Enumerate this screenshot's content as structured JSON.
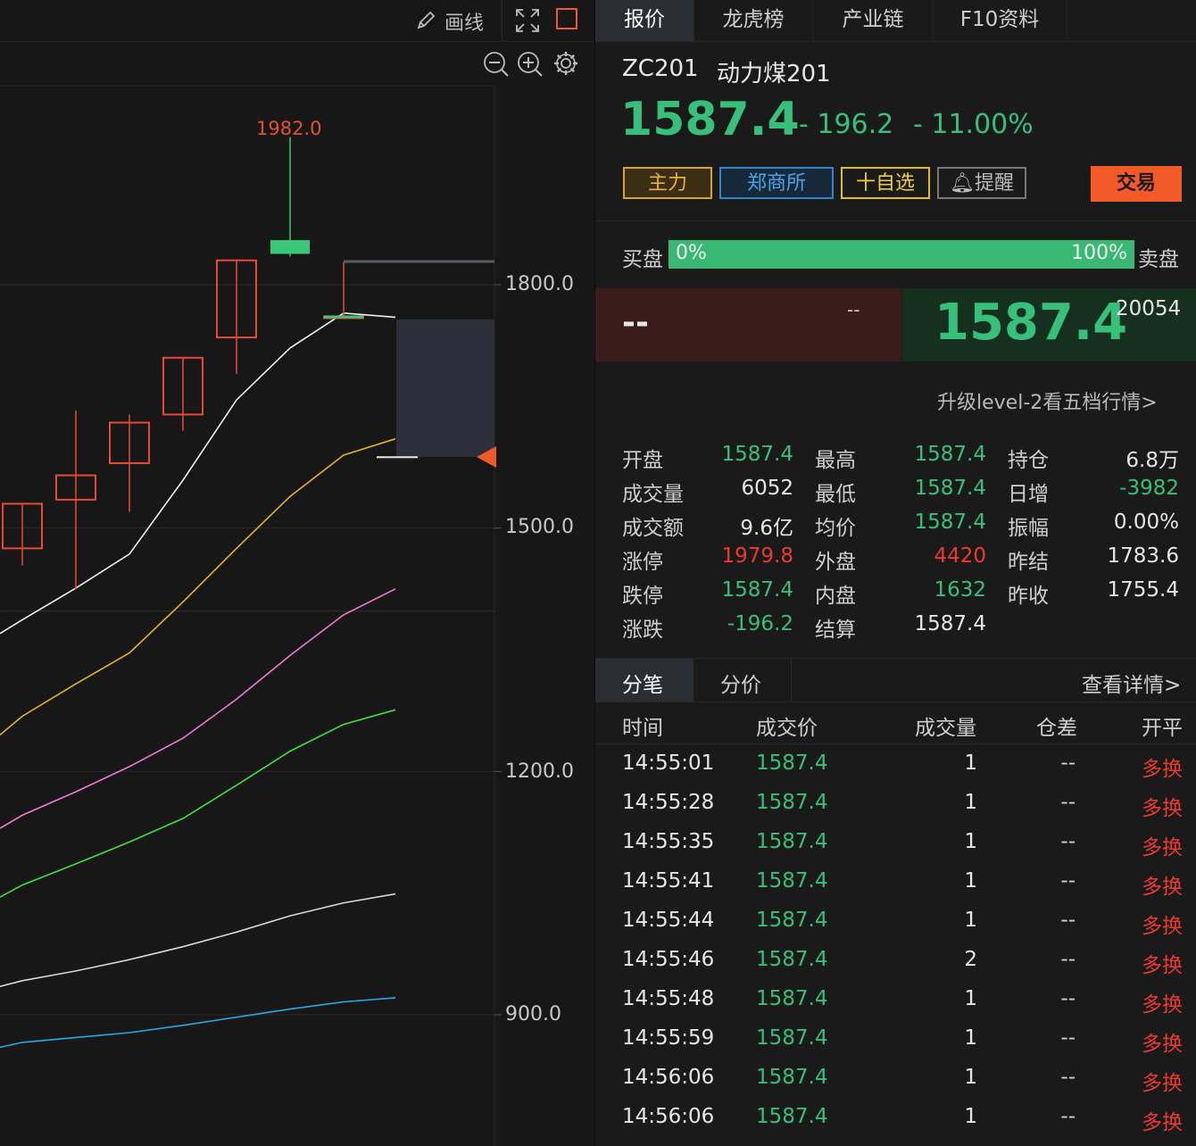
{
  "toolbar": {
    "draw_label": "画线"
  },
  "tabs": [
    {
      "label": "报价",
      "active": true
    },
    {
      "label": "龙虎榜",
      "active": false
    },
    {
      "label": "产业链",
      "active": false
    },
    {
      "label": "F10资料",
      "active": false
    }
  ],
  "instrument": {
    "code": "ZC201",
    "name": "动力煤201",
    "price": "1587.4",
    "change": "- 196.2",
    "change_pct": "- 11.00%"
  },
  "tags": {
    "main": "主力",
    "exchange": "郑商所",
    "watch": "十自选",
    "alert": "提醒",
    "trade": "交易"
  },
  "orderbook": {
    "buy_label": "买盘",
    "sell_label": "卖盘",
    "buy_pct": "0%",
    "sell_pct": "100%",
    "sell_fill_fraction": 1.0,
    "bid_price": "--",
    "bid_volume": "--",
    "ask_price": "1587.4",
    "ask_volume": "20054",
    "upgrade_link": "升级level-2看五档行情>"
  },
  "stats": [
    [
      {
        "label": "开盘",
        "value": "1587.4",
        "color": "green"
      },
      {
        "label": "最高",
        "value": "1587.4",
        "color": "green"
      },
      {
        "label": "持仓",
        "value": "6.8万",
        "color": "white"
      }
    ],
    [
      {
        "label": "成交量",
        "value": "6052",
        "color": "white"
      },
      {
        "label": "最低",
        "value": "1587.4",
        "color": "green"
      },
      {
        "label": "日增",
        "value": "-3982",
        "color": "green"
      }
    ],
    [
      {
        "label": "成交额",
        "value": "9.6亿",
        "color": "white"
      },
      {
        "label": "均价",
        "value": "1587.4",
        "color": "green"
      },
      {
        "label": "振幅",
        "value": "0.00%",
        "color": "white"
      }
    ],
    [
      {
        "label": "涨停",
        "value": "1979.8",
        "color": "red"
      },
      {
        "label": "外盘",
        "value": "4420",
        "color": "red"
      },
      {
        "label": "昨结",
        "value": "1783.6",
        "color": "white"
      }
    ],
    [
      {
        "label": "跌停",
        "value": "1587.4",
        "color": "green"
      },
      {
        "label": "内盘",
        "value": "1632",
        "color": "green"
      },
      {
        "label": "昨收",
        "value": "1755.4",
        "color": "white"
      }
    ],
    [
      {
        "label": "涨跌",
        "value": "-196.2",
        "color": "green"
      },
      {
        "label": "结算",
        "value": "1587.4",
        "color": "white"
      },
      {
        "label": "",
        "value": "",
        "color": "white"
      }
    ]
  ],
  "ticks_panel": {
    "tabs": [
      {
        "label": "分笔",
        "active": true
      },
      {
        "label": "分价",
        "active": false
      }
    ],
    "details_link": "查看详情>",
    "headers": [
      "时间",
      "成交价",
      "成交量",
      "仓差",
      "开平"
    ],
    "rows": [
      [
        "14:55:01",
        "1587.4",
        "1",
        "--",
        "多换"
      ],
      [
        "14:55:28",
        "1587.4",
        "1",
        "--",
        "多换"
      ],
      [
        "14:55:35",
        "1587.4",
        "1",
        "--",
        "多换"
      ],
      [
        "14:55:41",
        "1587.4",
        "1",
        "--",
        "多换"
      ],
      [
        "14:55:44",
        "1587.4",
        "1",
        "--",
        "多换"
      ],
      [
        "14:55:46",
        "1587.4",
        "2",
        "--",
        "多换"
      ],
      [
        "14:55:48",
        "1587.4",
        "1",
        "--",
        "多换"
      ],
      [
        "14:55:59",
        "1587.4",
        "1",
        "--",
        "多换"
      ],
      [
        "14:56:06",
        "1587.4",
        "1",
        "--",
        "多换"
      ],
      [
        "14:56:06",
        "1587.4",
        "1",
        "--",
        "多换"
      ]
    ]
  },
  "chart_data": {
    "type": "candlestick",
    "y_ticks": [
      "1800.0",
      "1500.0",
      "1200.0",
      "900.0"
    ],
    "high_label": "1982.0",
    "candles": [
      {
        "open": 1475,
        "close": 1530,
        "high": 1530,
        "low": 1454
      },
      {
        "open": 1535,
        "close": 1565,
        "high": 1645,
        "low": 1425
      },
      {
        "open": 1580,
        "close": 1630,
        "high": 1640,
        "low": 1520
      },
      {
        "open": 1640,
        "close": 1710,
        "high": 1710,
        "low": 1620
      },
      {
        "open": 1735,
        "close": 1830,
        "high": 1830,
        "low": 1690
      },
      {
        "open": 1855,
        "close": 1838,
        "high": 1982,
        "low": 1835
      },
      {
        "open": 1761,
        "close": 1761,
        "high": 1828,
        "low": 1761
      },
      {
        "open": 1587.4,
        "close": 1587.4,
        "high": 1587.4,
        "low": 1587.4
      }
    ],
    "ma_series": [
      {
        "color": "#f0f0f0",
        "values": [
          1370,
          1387,
          1426,
          1468,
          1559,
          1658,
          1722,
          1765,
          1760
        ]
      },
      {
        "color": "#e6b422",
        "values": [
          1245,
          1268,
          1308,
          1346,
          1409,
          1475,
          1539,
          1590,
          1610
        ]
      },
      {
        "color": "#f07ad6",
        "values": [
          1130,
          1146,
          1175,
          1206,
          1241,
          1289,
          1343,
          1393,
          1425
        ]
      },
      {
        "color": "#40e040",
        "values": [
          1045,
          1060,
          1086,
          1113,
          1142,
          1183,
          1225,
          1258,
          1276
        ]
      },
      {
        "color": "#d8d8d8",
        "values": [
          935,
          942,
          954,
          968,
          984,
          1002,
          1022,
          1038,
          1049
        ]
      },
      {
        "color": "#29a8e6",
        "values": [
          860,
          866,
          872,
          878,
          887,
          897,
          907,
          916,
          921
        ]
      }
    ],
    "current_price": 1587.4,
    "prev_settle": 1783.6
  }
}
